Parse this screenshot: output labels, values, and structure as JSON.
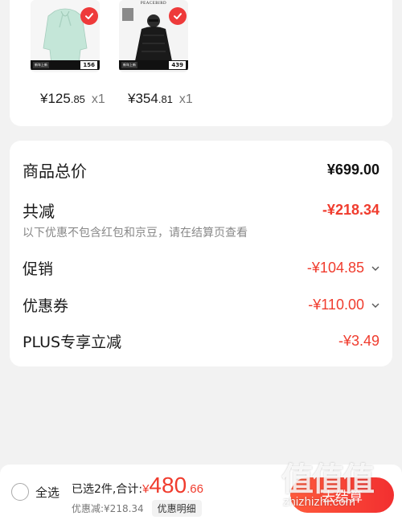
{
  "products": [
    {
      "price_int": "¥125",
      "price_dec": ".85",
      "qty": "x1",
      "tag_price": "156",
      "tag_chip": "新年上新",
      "brand": "",
      "colors": {
        "garment": "#bfe3d4"
      }
    },
    {
      "price_int": "¥354",
      "price_dec": ".81",
      "qty": "x1",
      "tag_price": "439",
      "tag_chip": "新年上新",
      "brand": "PEACEBIRD",
      "colors": {
        "garment": "#1b1b1b"
      }
    }
  ],
  "summary": {
    "total_label": "商品总价",
    "total_value": "¥699.00",
    "reduce_label": "共减",
    "reduce_value": "-¥218.34",
    "note": "以下优惠不包含红包和京豆，请在结算页查看",
    "promo_label": "促销",
    "promo_value": "-¥104.85",
    "coupon_label": "优惠券",
    "coupon_value": "-¥110.00",
    "plus_label": "PLUS专享立减",
    "plus_value": "-¥3.49"
  },
  "bottom": {
    "select_all": "全选",
    "selected_text": "已选2件,合计:",
    "total_symbol": "¥",
    "total_int": "480",
    "total_dec": ".66",
    "discount_text": "优惠减:¥218.34",
    "detail_button": "优惠明细",
    "checkout_button": "去结算"
  },
  "watermark": {
    "logo": "值值值",
    "url": "zhizhizhi.com"
  },
  "colors": {
    "accent": "#f03c2e",
    "background": "#f2f2f2"
  }
}
